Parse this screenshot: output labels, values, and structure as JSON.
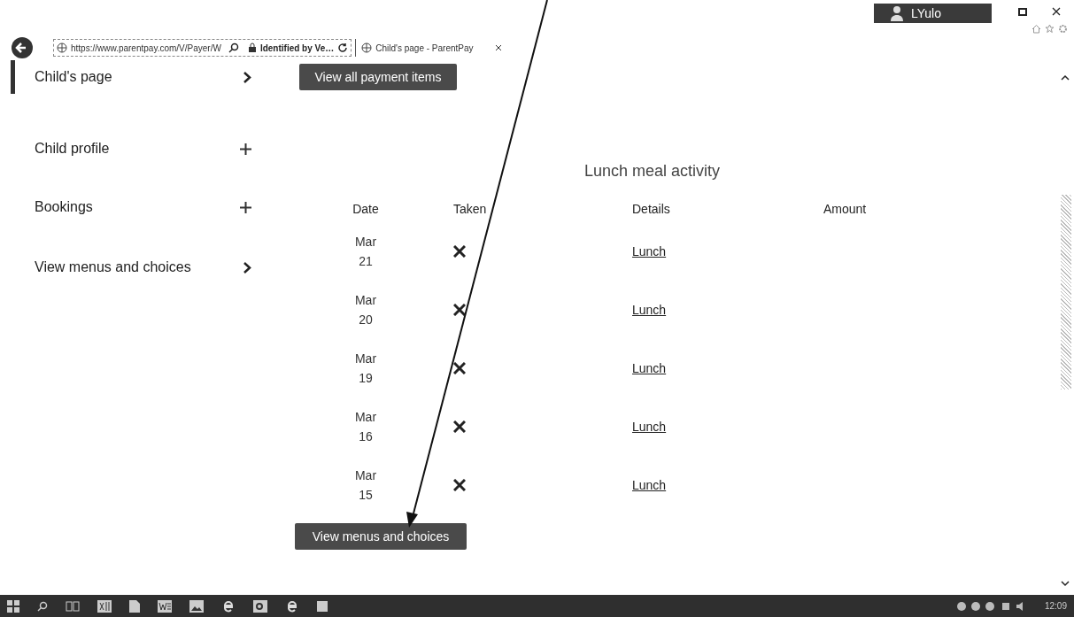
{
  "browser": {
    "url": "https://www.parentpay.com/V/Payer/W",
    "security": "Identified by Ve…",
    "tab_title": "Child's page - ParentPay"
  },
  "user": {
    "name": "LYulo"
  },
  "sidebar": {
    "items": [
      {
        "label": "Child's page",
        "kind": "chevron",
        "selected": true
      },
      {
        "label": "Child profile",
        "kind": "plus",
        "selected": false
      },
      {
        "label": "Bookings",
        "kind": "plus",
        "selected": false
      },
      {
        "label": "View menus and choices",
        "kind": "chevron",
        "selected": false
      }
    ]
  },
  "top_button": "View all payment items",
  "table": {
    "title": "Lunch meal activity",
    "columns": [
      "Date",
      "Taken",
      "Details",
      "Amount"
    ],
    "rows": [
      {
        "month": "Mar",
        "day": "21",
        "taken": false,
        "details": "Lunch"
      },
      {
        "month": "Mar",
        "day": "20",
        "taken": false,
        "details": "Lunch"
      },
      {
        "month": "Mar",
        "day": "19",
        "taken": false,
        "details": "Lunch"
      },
      {
        "month": "Mar",
        "day": "16",
        "taken": false,
        "details": "Lunch"
      },
      {
        "month": "Mar",
        "day": "15",
        "taken": false,
        "details": "Lunch"
      }
    ]
  },
  "bottom_button": "View menus and choices",
  "taskbar": {
    "clock": "12:09"
  }
}
